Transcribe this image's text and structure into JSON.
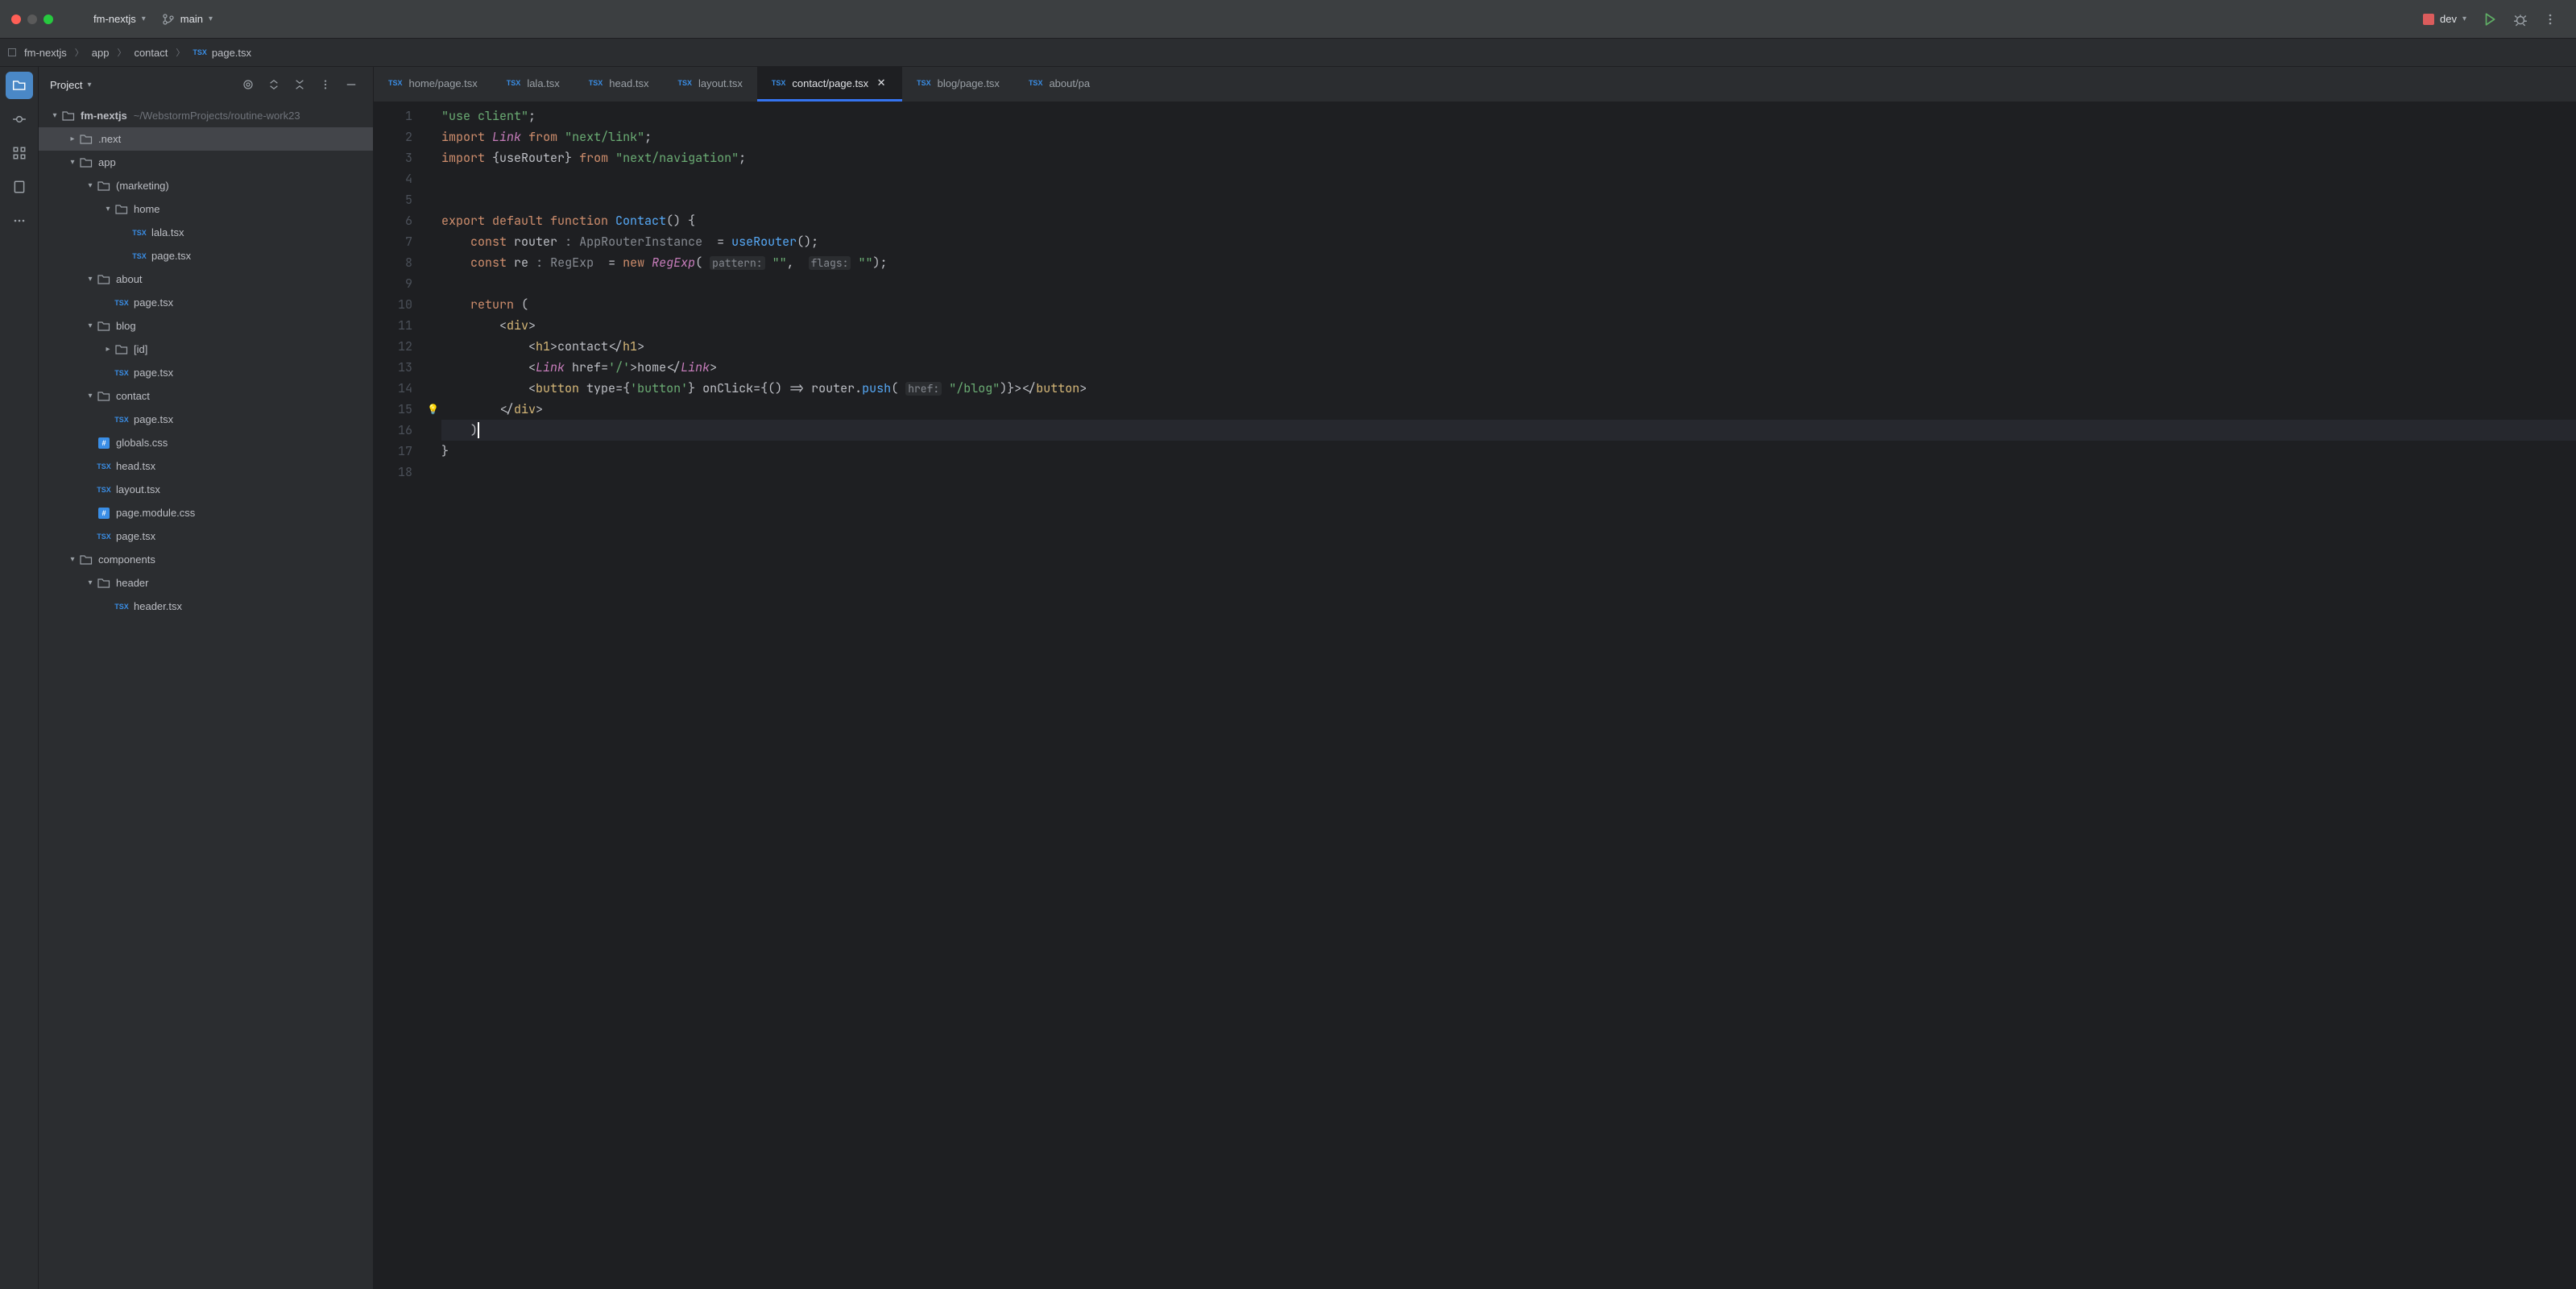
{
  "titlebar": {
    "project": "fm-nextjs",
    "branch": "main",
    "run_config": "dev"
  },
  "breadcrumb": [
    "fm-nextjs",
    "app",
    "contact",
    "page.tsx"
  ],
  "sidebar": {
    "title": "Project",
    "tree": {
      "root": {
        "label": "fm-nextjs",
        "path": "~/WebstormProjects/routine-work23"
      },
      "items": [
        {
          "label": ".next",
          "depth": 1,
          "type": "folder",
          "arrow": "right",
          "highlight": true
        },
        {
          "label": "app",
          "depth": 1,
          "type": "folder",
          "arrow": "down"
        },
        {
          "label": "(marketing)",
          "depth": 2,
          "type": "folder",
          "arrow": "down"
        },
        {
          "label": "home",
          "depth": 3,
          "type": "folder",
          "arrow": "down"
        },
        {
          "label": "lala.tsx",
          "depth": 4,
          "type": "tsx"
        },
        {
          "label": "page.tsx",
          "depth": 4,
          "type": "tsx"
        },
        {
          "label": "about",
          "depth": 2,
          "type": "folder",
          "arrow": "down"
        },
        {
          "label": "page.tsx",
          "depth": 3,
          "type": "tsx"
        },
        {
          "label": "blog",
          "depth": 2,
          "type": "folder",
          "arrow": "down"
        },
        {
          "label": "[id]",
          "depth": 3,
          "type": "folder",
          "arrow": "right"
        },
        {
          "label": "page.tsx",
          "depth": 3,
          "type": "tsx"
        },
        {
          "label": "contact",
          "depth": 2,
          "type": "folder",
          "arrow": "down"
        },
        {
          "label": "page.tsx",
          "depth": 3,
          "type": "tsx"
        },
        {
          "label": "globals.css",
          "depth": 2,
          "type": "css"
        },
        {
          "label": "head.tsx",
          "depth": 2,
          "type": "tsx"
        },
        {
          "label": "layout.tsx",
          "depth": 2,
          "type": "tsx"
        },
        {
          "label": "page.module.css",
          "depth": 2,
          "type": "css"
        },
        {
          "label": "page.tsx",
          "depth": 2,
          "type": "tsx"
        },
        {
          "label": "components",
          "depth": 1,
          "type": "folder",
          "arrow": "down"
        },
        {
          "label": "header",
          "depth": 2,
          "type": "folder",
          "arrow": "down"
        },
        {
          "label": "header.tsx",
          "depth": 3,
          "type": "tsx"
        }
      ]
    }
  },
  "tabs": [
    {
      "label": "home/page.tsx"
    },
    {
      "label": "lala.tsx"
    },
    {
      "label": "head.tsx"
    },
    {
      "label": "layout.tsx"
    },
    {
      "label": "contact/page.tsx",
      "active": true
    },
    {
      "label": "blog/page.tsx"
    },
    {
      "label": "about/pa"
    }
  ],
  "code": {
    "lines": [
      {
        "n": 1,
        "html": "<span class='str'>\"use client\"</span>;"
      },
      {
        "n": 2,
        "html": "<span class='kw'>import</span> <span class='cls'>Link</span> <span class='kw'>from</span> <span class='str'>\"next/link\"</span>;"
      },
      {
        "n": 3,
        "html": "<span class='kw'>import</span> {<span class='type'>useRouter</span>} <span class='kw'>from</span> <span class='str'>\"next/navigation\"</span>;"
      },
      {
        "n": 4,
        "html": ""
      },
      {
        "n": 5,
        "html": ""
      },
      {
        "n": 6,
        "html": "<span class='kw'>export default function</span> <span class='fn'>Contact</span>() {"
      },
      {
        "n": 7,
        "html": "    <span class='kw'>const</span> <span class='type'>router</span> <span class='type-hint'>: AppRouterInstance</span>  = <span class='fn'>useRouter</span>();"
      },
      {
        "n": 8,
        "html": "    <span class='kw'>const</span> <span class='type'>re</span> <span class='type-hint'>: RegExp</span>  = <span class='kw'>new</span> <span class='cls'>RegExp</span>( <span class='param-hint'>pattern:</span> <span class='str'>\"\"</span>,  <span class='param-hint'>flags:</span> <span class='str'>\"\"</span>);"
      },
      {
        "n": 9,
        "html": ""
      },
      {
        "n": 10,
        "html": "    <span class='kw'>return</span> ("
      },
      {
        "n": 11,
        "html": "        &lt;<span class='tag'>div</span>&gt;"
      },
      {
        "n": 12,
        "html": "            &lt;<span class='tag'>h1</span>&gt;contact&lt;/<span class='tag'>h1</span>&gt;"
      },
      {
        "n": 13,
        "html": "            &lt;<span class='cls'>Link</span> <span class='attr'>href</span>=<span class='str'>'/'</span>&gt;home&lt;/<span class='cls'>Link</span>&gt;"
      },
      {
        "n": 14,
        "html": "            &lt;<span class='tag'>button</span> <span class='attr'>type</span>={<span class='str'>'button'</span>} <span class='attr'>onClick</span>={() =&gt; <span class='type'>router</span>.<span class='fn'>push</span>( <span class='param-hint'>href:</span> <span class='str'>\"/blog\"</span>)}&gt;&lt;/<span class='tag'>button</span>&gt;"
      },
      {
        "n": 15,
        "html": "        &lt;/<span class='tag'>div</span>&gt;",
        "bulb": true
      },
      {
        "n": 16,
        "html": "    )<span class='caret'></span>",
        "hl": true
      },
      {
        "n": 17,
        "html": "}"
      },
      {
        "n": 18,
        "html": ""
      }
    ]
  }
}
